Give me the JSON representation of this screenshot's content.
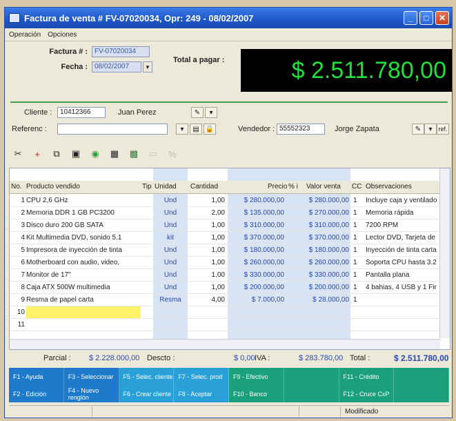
{
  "window": {
    "title": "Factura de venta # FV-07020034, Opr: 249 - 08/02/2007"
  },
  "menu": [
    "Operación",
    "Opciones"
  ],
  "header": {
    "factura_label": "Factura # :",
    "factura_value": "FV-07020034",
    "fecha_label": "Fecha :",
    "fecha_value": "08/02/2007",
    "total_label": "Total a pagar :",
    "total_value": "$ 2.511.780,00"
  },
  "client": {
    "cliente_label": "Cliente :",
    "cliente_id": "10412366",
    "cliente_name": "Juan Perez",
    "referenc_label": "Referenc :",
    "referenc_value": "",
    "vendedor_label": "Vendedor :",
    "vendedor_id": "55552323",
    "vendedor_name": "Jorge Zapata",
    "ref_button": "ref."
  },
  "grid": {
    "headers": [
      "No.",
      "Producto vendido",
      "Tip",
      "Unidad",
      "Cantidad",
      "Precio",
      "% i",
      "Valor venta",
      "CC",
      "Observaciones"
    ],
    "rows": [
      {
        "no": "1",
        "producto": "CPU 2,6 GHz",
        "unidad": "Und",
        "cantidad": "1,00",
        "precio": "$ 280.000,00",
        "valor": "$ 280.000,00",
        "cc": "1",
        "obs": "Incluye caja y ventilado"
      },
      {
        "no": "2",
        "producto": "Memoria DDR 1 GB PC3200",
        "unidad": "Und",
        "cantidad": "2,00",
        "precio": "$ 135.000,00",
        "valor": "$ 270.000,00",
        "cc": "1",
        "obs": "Memoria rápida"
      },
      {
        "no": "3",
        "producto": "Disco duro 200 GB SATA",
        "unidad": "Und",
        "cantidad": "1,00",
        "precio": "$ 310.000,00",
        "valor": "$ 310.000,00",
        "cc": "1",
        "obs": "7200 RPM"
      },
      {
        "no": "4",
        "producto": "Kit Multimedia DVD, sonido 5.1",
        "unidad": "kit",
        "cantidad": "1,00",
        "precio": "$ 370.000,00",
        "valor": "$ 370.000,00",
        "cc": "1",
        "obs": "Lector DVD, Tarjeta de"
      },
      {
        "no": "5",
        "producto": "Impresora de inyección de tinta",
        "unidad": "Und",
        "cantidad": "1,00",
        "precio": "$ 180.000,00",
        "valor": "$ 180.000,00",
        "cc": "1",
        "obs": "Inyección de tinta carta"
      },
      {
        "no": "6",
        "producto": "Motherboard con audio, video,",
        "unidad": "Und",
        "cantidad": "1,00",
        "precio": "$ 260.000,00",
        "valor": "$ 260.000,00",
        "cc": "1",
        "obs": "Soporta CPU hasta 3.2"
      },
      {
        "no": "7",
        "producto": "Monitor de 17\"",
        "unidad": "Und",
        "cantidad": "1,00",
        "precio": "$ 330.000,00",
        "valor": "$ 330.000,00",
        "cc": "1",
        "obs": "Pantalla plana"
      },
      {
        "no": "8",
        "producto": "Caja ATX 500W multimedia",
        "unidad": "Und",
        "cantidad": "1,00",
        "precio": "$ 200.000,00",
        "valor": "$ 200.000,00",
        "cc": "1",
        "obs": "4 bahias, 4 USB y 1 Fir"
      },
      {
        "no": "9",
        "producto": "Resma de papel carta",
        "unidad": "Resma",
        "cantidad": "4,00",
        "precio": "$ 7.000,00",
        "valor": "$ 28.000,00",
        "cc": "1",
        "obs": ""
      },
      {
        "no": "10",
        "producto": "",
        "unidad": "",
        "cantidad": "",
        "precio": "",
        "valor": "",
        "cc": "",
        "obs": ""
      },
      {
        "no": "11",
        "producto": "",
        "unidad": "",
        "cantidad": "",
        "precio": "",
        "valor": "",
        "cc": "",
        "obs": ""
      }
    ]
  },
  "totals": {
    "parcial_label": "Parcial :",
    "parcial_value": "$ 2.228.000,00",
    "descto_label": "Descto :",
    "descto_value": "$ 0,00",
    "iva_label": "IVA :",
    "iva_value": "$ 283.780,00",
    "total_label": "Total :",
    "total_value": "$ 2.511.780,00"
  },
  "fkeys": [
    "F1 - Ayuda",
    "F3 - Seleccionar",
    "F5 - Selec. cliente",
    "F7 - Selec. prod",
    "F9 - Efectivo",
    "",
    "F11 - Crédito",
    "",
    "F2 - Edición",
    "F4 - Nuevo renglón",
    "F6 - Crear cliente",
    "F8 - Aceptar",
    "F10 - Banco",
    "",
    "F12 - Cruce CxP",
    ""
  ],
  "status": {
    "text": "Modificado"
  },
  "colors": {
    "accent": "#1e56c8",
    "total_green": "#22e13a",
    "highlight": "#fff26a"
  }
}
